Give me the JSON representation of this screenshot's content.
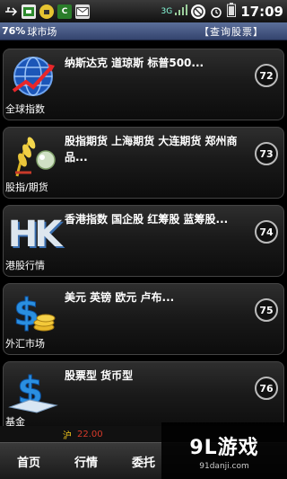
{
  "status_bar": {
    "time": "17:09",
    "icons": [
      "usb-icon",
      "sd-card-icon",
      "android-icon",
      "notification-c-icon",
      "mail-icon",
      "3g-icon",
      "signal-icon",
      "no-sim-icon",
      "alarm-icon",
      "battery-icon"
    ],
    "carrier_tag": "C",
    "network_label": "3G"
  },
  "title_bar": {
    "percent": "76%",
    "title": "球市场",
    "link": "【查询股票】"
  },
  "cards": [
    {
      "caption": "全球指数",
      "text": "纳斯达克  道琼斯  标普500...",
      "badge": "72"
    },
    {
      "caption": "股指/期货",
      "text": "股指期货  上海期货  大连期货 郑州商品...",
      "badge": "73"
    },
    {
      "caption": "港股行情",
      "text": "香港指数  国企股  红筹股  蓝筹股...",
      "badge": "74"
    },
    {
      "caption": "外汇市场",
      "text": "美元  英镑  欧元  卢布...",
      "badge": "75"
    },
    {
      "caption": "基金",
      "text": "股票型  货币型",
      "badge": "76"
    }
  ],
  "icons": {
    "card_icons": [
      "globe-icon",
      "wheat-commodity-icon",
      "hk-letters-icon",
      "dollar-coins-icon",
      "dollar-fund-icon"
    ],
    "hk_text": "HK"
  },
  "ticker": {
    "label": "沪",
    "value": "22.00"
  },
  "tabs": [
    "首页",
    "行情",
    "委托"
  ],
  "watermark": {
    "logo": "9L游戏",
    "url": "91danji.com"
  },
  "colors": {
    "title_bar": "#4a5c88",
    "ticker_label": "#f4c81c",
    "ticker_value": "#d83a2a"
  }
}
